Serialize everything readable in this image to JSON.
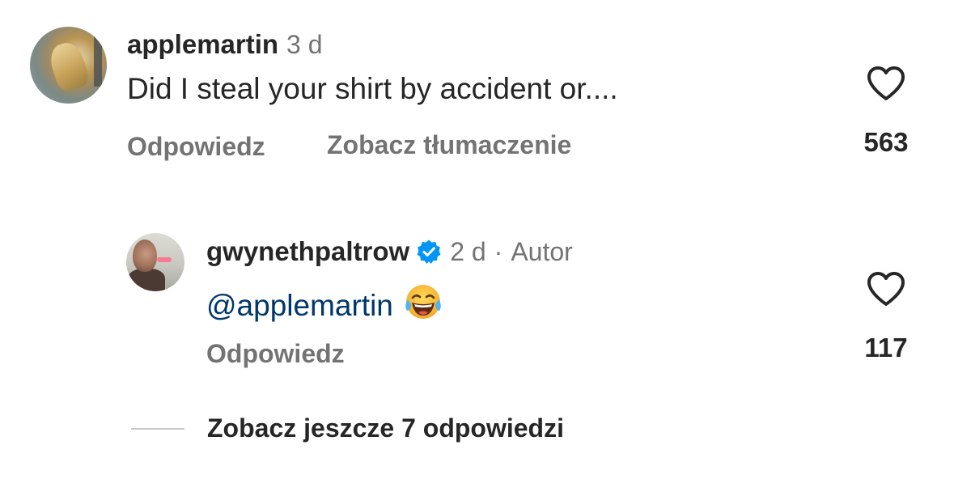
{
  "comments": [
    {
      "username": "applemartin",
      "time": "3 d",
      "text": "Did I steal your shirt by accident or....",
      "reply_label": "Odpowiedz",
      "translate_label": "Zobacz tłumaczenie",
      "likes": "563",
      "avatar_icon": "avatar-photo"
    },
    {
      "username": "gwynethpaltrow",
      "verified": true,
      "time": "2 d",
      "separator": "·",
      "author_label": "Autor",
      "mention": "@applemartin",
      "emoji_icon": "face-with-tears-of-joy-emoji",
      "reply_label": "Odpowiedz",
      "likes": "117",
      "avatar_icon": "avatar-photo"
    }
  ],
  "more_replies_label": "Zobacz jeszcze 7 odpowiedzi",
  "colors": {
    "primary_text": "#262626",
    "secondary_text": "#737373",
    "mention": "#00376b",
    "verified_badge": "#0095f6"
  }
}
